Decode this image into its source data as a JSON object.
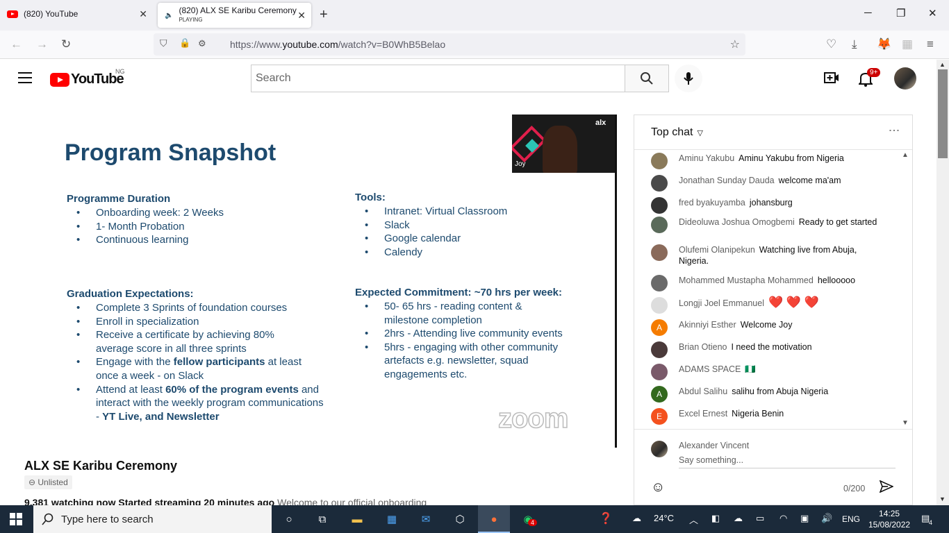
{
  "browser": {
    "tabs": [
      {
        "title": "(820) YouTube"
      },
      {
        "title": "(820) ALX SE Karibu Ceremony",
        "sub": "PLAYING"
      }
    ],
    "url_prefix": "https://www.",
    "url_domain": "youtube.com",
    "url_rest": "/watch?v=B0WhB5Belao"
  },
  "youtube": {
    "logo_text": "YouTube",
    "country": "NG",
    "search_placeholder": "Search",
    "notif_badge": "9+"
  },
  "slide": {
    "title": "Program Snapshot",
    "duration_head": "Programme Duration",
    "duration": [
      "Onboarding week: 2 Weeks",
      "1- Month Probation",
      "Continuous learning"
    ],
    "tools_head": "Tools:",
    "tools": [
      "Intranet: Virtual Classroom",
      "Slack",
      "Google calendar",
      "Calendy"
    ],
    "grad_head": "Graduation Expectations:",
    "grad": [
      "Complete 3 Sprints of foundation courses",
      "Enroll in specialization",
      "Receive a certificate by achieving 80% average score in all three sprints"
    ],
    "grad4": {
      "pre": "Engage with the ",
      "bold": "fellow participants",
      "post": " at least once a week - on Slack"
    },
    "grad5": {
      "pre": "Attend at least ",
      "bold": "60% of the program events",
      "mid": " and interact with the weekly program communications - ",
      "bold2": "YT Live, and Newsletter"
    },
    "commit_head": "Expected Commitment: ~70 hrs per week:",
    "commit": [
      "50- 65 hrs - reading content & milestone completion",
      "2hrs - Attending live community events",
      "5hrs - engaging with other community artefacts e.g. newsletter, squad engagements etc."
    ],
    "cam_name": "Joy",
    "cam_brand": "alx",
    "zoom": "zoom"
  },
  "video": {
    "title": "ALX SE Karibu Ceremony",
    "unlisted": "Unlisted",
    "meta_bold": "9,381 watching now  Started streaming 20 minutes ago",
    "meta_rest": "  Welcome to our official onboarding"
  },
  "chat": {
    "header": "Top chat",
    "messages": [
      {
        "author": "Aminu Yakubu",
        "text": "Aminu Yakubu from Nigeria",
        "color": "#8a7a5a"
      },
      {
        "author": "Jonathan Sunday Dauda",
        "text": "welcome ma'am",
        "color": "#4a4a4a"
      },
      {
        "author": "fred byakuyamba",
        "text": "johansburg",
        "color": "#333333"
      },
      {
        "author": "Dideoluwa Joshua Omogbemi",
        "text": "Ready to get started",
        "color": "#5a6a5a"
      },
      {
        "author": "Olufemi Olanipekun",
        "text": "Watching live from Abuja, Nigeria.",
        "color": "#8a6a5a"
      },
      {
        "author": "Mohammed Mustapha Mohammed",
        "text": "hellooooo",
        "color": "#6a6a6a"
      },
      {
        "author": "Longji Joel Emmanuel",
        "text": "❤️ ❤️ ❤️",
        "color": "#dddddd"
      },
      {
        "author": "Akinniyi Esther",
        "text": "Welcome Joy",
        "letter": "A",
        "color": "#f57c00"
      },
      {
        "author": "Brian Otieno",
        "text": "I need the motivation",
        "color": "#4a3a3a"
      },
      {
        "author": "ADAMS SPACE",
        "text": "🇳🇬",
        "color": "#7a5a6a"
      },
      {
        "author": "Abdul Salihu",
        "text": "salihu from Abuja Nigeria",
        "letter": "A",
        "color": "#33691e"
      },
      {
        "author": "Excel Ernest",
        "text": "Nigeria Benin",
        "letter": "E",
        "color": "#f4511e"
      }
    ],
    "me": "Alexander Vincent",
    "placeholder": "Say something...",
    "counter": "0/200"
  },
  "taskbar": {
    "search": "Type here to search",
    "weather": "24°C",
    "lang": "ENG",
    "time": "14:25",
    "date": "15/08/2022",
    "whatsapp_badge": "4",
    "notif_count": "4"
  }
}
